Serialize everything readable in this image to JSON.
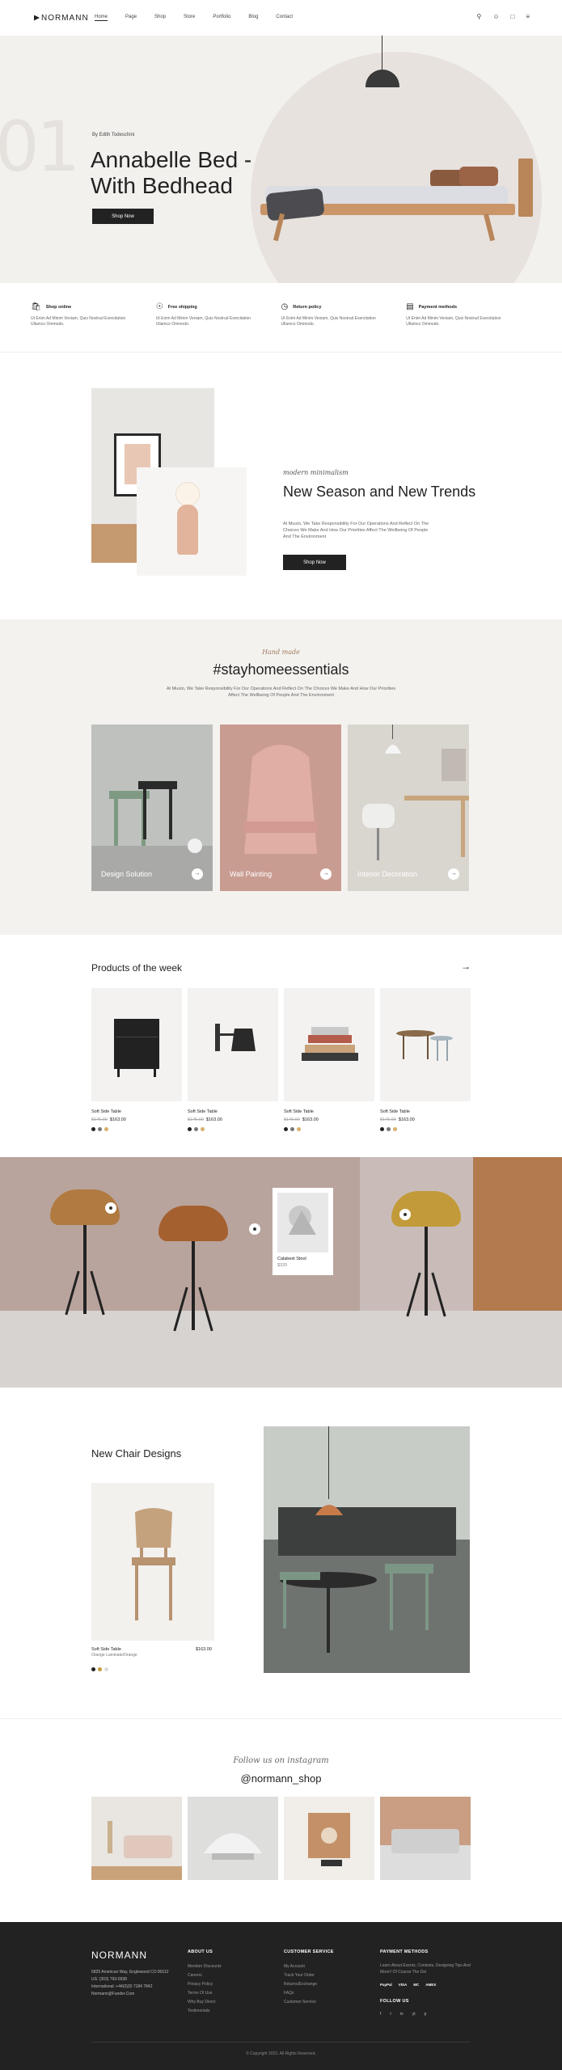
{
  "header": {
    "logo": "NORMANN",
    "nav": [
      "Home",
      "Page",
      "Shop",
      "Store",
      "Portfolio",
      "Blog",
      "Contact"
    ],
    "icons": [
      "search-icon",
      "user-icon",
      "cart-icon",
      "menu-icon"
    ]
  },
  "hero": {
    "number": "01",
    "by": "By Edith Todeschini",
    "title": "Annabelle Bed - With Bedhead",
    "button": "Shop Now"
  },
  "features": [
    {
      "icon": "bag-icon",
      "title": "Shop online",
      "text": "Ut Enim Ad Minim Veniam, Quis Nostrud Exercitation Ullamco Ommodo."
    },
    {
      "icon": "dollar-icon",
      "title": "Free shipping",
      "text": "Ut Enim Ad Minim Veniam, Quis Nostrud Exercitation Ullamco Ommodo."
    },
    {
      "icon": "clock-icon",
      "title": "Return policy",
      "text": "Ut Enim Ad Minim Veniam, Quis Nostrud Exercitation Ullamco Ommodo."
    },
    {
      "icon": "card-icon",
      "title": "Payment methods",
      "text": "Ut Enim Ad Minim Veniam, Quis Nostrud Exercitation Ullamco Ommodo."
    }
  ],
  "season": {
    "script": "modern minimalism",
    "title": "New Season and New Trends",
    "text": "At Muuto, We Take Responsibility For Our Operations And Reflect On The Choices We Make And How Our Priorities Affect The Wellbeing Of People And The Environment",
    "button": "Shop Now"
  },
  "stay": {
    "script": "Hand made",
    "title": "#stayhomeessentials",
    "text": "At Muuto, We Take Responsibility For Our Operations And Reflect On The Choices We Make And How Our Priorities Affect The Wellbeing Of People And The Environment",
    "categories": [
      "Design Solution",
      "Wall Painting",
      "Interior Decoration"
    ]
  },
  "products": {
    "title": "Products of the week",
    "items": [
      {
        "name": "Soft Side Table",
        "old_price": "$175.00",
        "price": "$163.00"
      },
      {
        "name": "Soft Side Table",
        "old_price": "$175.00",
        "price": "$163.00"
      },
      {
        "name": "Soft Side Table",
        "old_price": "$175.00",
        "price": "$163.00"
      },
      {
        "name": "Soft Side Table",
        "old_price": "$175.00",
        "price": "$163.00"
      }
    ]
  },
  "lookbook": {
    "card_name": "Calabest Stool",
    "card_price": "$320"
  },
  "newchair": {
    "title": "New Chair Designs",
    "name": "Soft Side Table",
    "sub": "Orange Laminate/Orange",
    "price": "$163.00"
  },
  "instagram": {
    "script": "Follow us on instagram",
    "handle": "@normann_shop"
  },
  "footer": {
    "logo": "NORMANN",
    "address": "5825 American Way, Englewood CO 80112",
    "phone": "US: (303) 793-0938",
    "intl": "International: +44(0)20 7184 7842",
    "email": "Normann@Funder.Com",
    "about_title": "ABOUT US",
    "about_links": [
      "Member Discounts",
      "Careers",
      "Privacy Policy",
      "Terms Of Use",
      "Why Buy Direct",
      "Testimonials"
    ],
    "service_title": "CUSTOMER SERVICE",
    "service_links": [
      "My Account",
      "Track Your Order",
      "Returns/Exchange",
      "FAQs",
      "Customer Service"
    ],
    "payment_title": "PAYMENT METHODS",
    "payment_text": "Learn About Events, Contests, Designing Tips And More!! Of Course The Dei",
    "payments": [
      "PayPal",
      "VISA",
      "MC",
      "AMEX"
    ],
    "follow_title": "FOLLOW US",
    "social": [
      "f",
      "t",
      "in",
      "yt",
      "p"
    ],
    "copyright": "© Copyright 2023. All Rights Reserved."
  }
}
